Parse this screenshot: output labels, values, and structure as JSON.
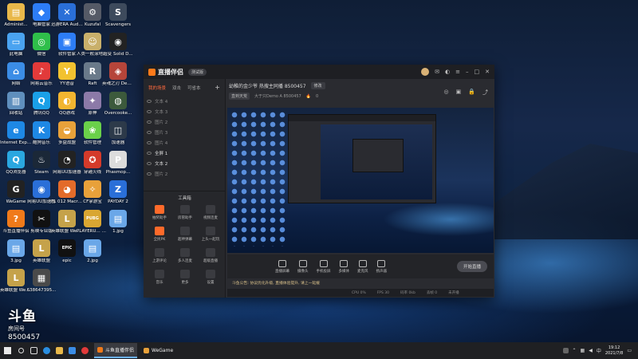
{
  "desktop": {
    "icons": [
      {
        "label": "Administ...",
        "color": "#e8b84a",
        "glyph": "▤"
      },
      {
        "label": "电脑管家",
        "color": "#2d7df6",
        "glyph": "◆"
      },
      {
        "label": "迅游ERA Audio ...",
        "color": "#2a6fd8",
        "glyph": "✕"
      },
      {
        "label": "Kuzufal",
        "color": "#555a66",
        "glyph": "⚙"
      },
      {
        "label": "Scavengers",
        "color": "#3d4a5c",
        "glyph": "S"
      },
      {
        "label": "此电脑",
        "color": "#4aa3f0",
        "glyph": "▭"
      },
      {
        "label": "微信",
        "color": "#2fbf4a",
        "glyph": "◎"
      },
      {
        "label": "软件管家",
        "color": "#2d7df6",
        "glyph": "▣"
      },
      {
        "label": "人类一败涂地 Human Fa...",
        "color": "#c9b06b",
        "glyph": "☺"
      },
      {
        "label": "超变 Solid D...",
        "color": "#222",
        "glyph": "◉"
      },
      {
        "label": "网络",
        "color": "#3b8de6",
        "glyph": "⌂"
      },
      {
        "label": "网易云音乐",
        "color": "#e23a3a",
        "glyph": "♪"
      },
      {
        "label": "YY语音",
        "color": "#f2c230",
        "glyph": "Y"
      },
      {
        "label": "Raft",
        "color": "#6a7a8a",
        "glyph": "R"
      },
      {
        "label": "英魂之刃 Demo",
        "color": "#b6453a",
        "glyph": "◈"
      },
      {
        "label": "回收站",
        "color": "#5f8fbd",
        "glyph": "▥"
      },
      {
        "label": "腾讯QQ",
        "color": "#1aa0e8",
        "glyph": "Q"
      },
      {
        "label": "QQ游戏",
        "color": "#f2b530",
        "glyph": "◐"
      },
      {
        "label": "原神",
        "color": "#8c7aa8",
        "glyph": "✦"
      },
      {
        "label": "Overcooke...",
        "color": "#3c5a3c",
        "glyph": "◍"
      },
      {
        "label": "Internet Explorer",
        "color": "#1e88e5",
        "glyph": "e"
      },
      {
        "label": "酷狗音乐",
        "color": "#1e88e5",
        "glyph": "K"
      },
      {
        "label": "多益战盟",
        "color": "#e8a13a",
        "glyph": "◒"
      },
      {
        "label": "软件管理",
        "color": "#6ad04a",
        "glyph": "❀"
      },
      {
        "label": "加速器",
        "color": "#2d3a4a",
        "glyph": "◫"
      },
      {
        "label": "QQ浏览器",
        "color": "#2aa7e0",
        "glyph": "Q"
      },
      {
        "label": "Steam",
        "color": "#1b2838",
        "glyph": "♨"
      },
      {
        "label": "网易UU加速器",
        "color": "#222",
        "glyph": "◔"
      },
      {
        "label": "穿越火线",
        "color": "#d43a2a",
        "glyph": "✪"
      },
      {
        "label": "Phasmop...",
        "color": "#dcdcdc",
        "glyph": "P"
      },
      {
        "label": "WeGame",
        "color": "#222",
        "glyph": "G"
      },
      {
        "label": "网易UU加速器",
        "color": "#2a6fd8",
        "glyph": "◉"
      },
      {
        "label": "FL 012 Macro ...",
        "color": "#e36b2a",
        "glyph": "◕"
      },
      {
        "label": "CF掌游宝",
        "color": "#e8a13a",
        "glyph": "✧"
      },
      {
        "label": "PAYDAY 2",
        "color": "#2a6fd8",
        "glyph": "Z"
      },
      {
        "label": "斗鱼直播伴侣",
        "color": "#f07a1a",
        "glyph": "?"
      },
      {
        "label": "剪映专业版",
        "color": "#111",
        "glyph": "✂"
      },
      {
        "label": "英雄联盟 WeGame版",
        "color": "#c5a24a",
        "glyph": "L"
      },
      {
        "label": "PLAYERU... BATTLEGR...",
        "color": "#d9a632",
        "glyph": "PUBG"
      },
      {
        "label": "1.jpg",
        "color": "#6aa7e8",
        "glyph": "▤"
      },
      {
        "label": "3.jpg",
        "color": "#6aa7e8",
        "glyph": "▤"
      },
      {
        "label": "英雄联盟",
        "color": "#c5a24a",
        "glyph": "L"
      },
      {
        "label": "epic",
        "color": "#111",
        "glyph": "EPIC"
      },
      {
        "label": "2.jpg",
        "color": "#6aa7e8",
        "glyph": "▤"
      },
      {
        "label": "英雄联盟 WeGame版",
        "color": "#c5a24a",
        "glyph": "L"
      },
      {
        "label": "638647395...",
        "color": "#4a4a4a",
        "glyph": "▦"
      }
    ]
  },
  "watermark": {
    "main": "斗鱼",
    "sub": "房间号",
    "room_id": "8500457"
  },
  "app": {
    "name": "直播伴侣",
    "version_badge": "测试版",
    "tabs": [
      "我的场景",
      "双击",
      "可省本"
    ],
    "tab_add": "+",
    "scenes": [
      {
        "label": "文本 4",
        "on": false
      },
      {
        "label": "文本 3",
        "on": false
      },
      {
        "label": "图片 2",
        "on": false
      },
      {
        "label": "图片 3",
        "on": false
      },
      {
        "label": "图片 4",
        "on": false
      },
      {
        "label": "全屏 1",
        "on": true
      },
      {
        "label": "文本 2",
        "on": true
      },
      {
        "label": "图片 2",
        "on": false
      }
    ],
    "tools_title": "工具箱",
    "tools": [
      {
        "label": "抽奖助手",
        "hot": true
      },
      {
        "label": "房管助手",
        "hot": false
      },
      {
        "label": "视频连麦",
        "hot": false
      },
      {
        "label": "全民PK",
        "hot": true
      },
      {
        "label": "超神弹幕",
        "hot": false
      },
      {
        "label": "上头一起玩",
        "hot": false
      },
      {
        "label": "上游评论",
        "hot": false
      },
      {
        "label": "多人连麦",
        "hot": false
      },
      {
        "label": "超级直播",
        "hot": false
      },
      {
        "label": "音乐",
        "hot": false
      },
      {
        "label": "更多",
        "hot": false
      },
      {
        "label": "设置",
        "hot": false
      }
    ],
    "room_title": "幼稚的金少爷 热搜主同播 8500457",
    "edit_label": "修改",
    "room_category": "直到天荒",
    "room_meta": "大于只Demo A  8500457",
    "room_hot": "0",
    "bottom_buttons": [
      {
        "label": "直播屏幕"
      },
      {
        "label": "摄像头"
      },
      {
        "label": "手机投屏"
      },
      {
        "label": "多媒体"
      },
      {
        "label": "麦克风"
      },
      {
        "label": "扬声器"
      }
    ],
    "live_button": "开始直播",
    "notice": "斗鱼公告: 协议优化升级, 直播体验提升, 请上一延缓",
    "status": [
      "CPU 0%",
      "FPS 30",
      "码率 0kb",
      "丢帧 0",
      "未开播"
    ]
  },
  "taskbar": {
    "tasks": [
      {
        "label": "斗鱼直播伴侣",
        "color": "#f07a1a",
        "active": true
      },
      {
        "label": "WeGame",
        "color": "#e8a13a",
        "active": false
      }
    ],
    "time": "19:12",
    "date": "2021/7/8"
  }
}
